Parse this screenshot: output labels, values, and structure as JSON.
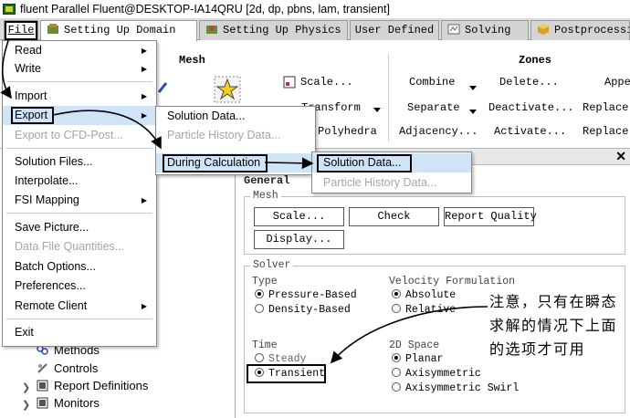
{
  "window": {
    "title": "fluent Parallel Fluent@DESKTOP-IA14QRU  [2d, dp, pbns, lam, transient]"
  },
  "tabs": {
    "file": "File",
    "items": [
      {
        "label": "Setting Up Domain",
        "icon": "domain-icon"
      },
      {
        "label": "Setting Up Physics",
        "icon": "physics-icon"
      },
      {
        "label": "User Defined",
        "icon": ""
      },
      {
        "label": "Solving",
        "icon": "solving-icon"
      },
      {
        "label": "Postprocessi",
        "icon": "postprocessing-icon"
      }
    ]
  },
  "ribbon": {
    "mesh_group": "Mesh",
    "zones_group": "Zones",
    "mesh_items": {
      "scale": "Scale...",
      "transform": "Transform",
      "polyhedra": "Polyhedra"
    },
    "zones": {
      "combine": "Combine",
      "delete": "Delete...",
      "append": "Appe",
      "separate": "Separate",
      "deactivate": "Deactivate...",
      "replace1": "Replace",
      "adjacency": "Adjacency...",
      "activate": "Activate...",
      "replace2": "Replace"
    }
  },
  "file_menu": {
    "items": [
      {
        "label": "Read",
        "submenu": true,
        "enabled": true
      },
      {
        "label": "Write",
        "submenu": true,
        "enabled": true
      },
      {
        "label": "Import",
        "submenu": true,
        "enabled": true
      },
      {
        "label": "Export",
        "submenu": true,
        "enabled": true
      },
      {
        "label": "Export to CFD-Post...",
        "submenu": false,
        "enabled": false
      },
      {
        "label": "Solution Files...",
        "submenu": false,
        "enabled": true
      },
      {
        "label": "Interpolate...",
        "submenu": false,
        "enabled": true
      },
      {
        "label": "FSI Mapping",
        "submenu": true,
        "enabled": true
      },
      {
        "label": "Save Picture...",
        "submenu": false,
        "enabled": true
      },
      {
        "label": "Data File Quantities...",
        "submenu": false,
        "enabled": false
      },
      {
        "label": "Batch Options...",
        "submenu": false,
        "enabled": true
      },
      {
        "label": "Preferences...",
        "submenu": false,
        "enabled": true
      },
      {
        "label": "Remote Client",
        "submenu": true,
        "enabled": true
      },
      {
        "label": "Exit",
        "submenu": false,
        "enabled": true
      }
    ]
  },
  "export_menu": {
    "solution_data": "Solution Data...",
    "particle_history": "Particle History Data...",
    "during_calc": "During Calculation"
  },
  "during_menu": {
    "solution_data": "Solution Data...",
    "particle_history": "Particle History Data..."
  },
  "tree": {
    "partial1": "s",
    "partial2": "ns",
    "items": [
      {
        "label": "Methods",
        "icon": "methods-icon"
      },
      {
        "label": "Controls",
        "icon": "controls-icon"
      },
      {
        "label": "Report Definitions",
        "icon": "report-definitions-icon"
      },
      {
        "label": "Monitors",
        "icon": "monitors-icon"
      }
    ]
  },
  "general": {
    "title": "General",
    "mesh_legend": "Mesh",
    "buttons": {
      "scale": "Scale...",
      "check": "Check",
      "report_quality": "Report Quality",
      "display": "Display..."
    },
    "solver_legend": "Solver",
    "type_label": "Type",
    "type_options": [
      "Pressure-Based",
      "Density-Based"
    ],
    "velocity_label": "Velocity Formulation",
    "velocity_options": [
      "Absolute",
      "Relative"
    ],
    "time_label": "Time",
    "time_options": [
      "Steady",
      "Transient"
    ],
    "space_label": "2D Space",
    "space_options": [
      "Planar",
      "Axisymmetric",
      "Axisymmetric Swirl"
    ]
  },
  "annotation": {
    "text": "注意，只有在瞬态求解的情况下上面的选项才可用",
    "color": "#000000"
  },
  "colors": {
    "highlight": "#cfe4f7",
    "disabled_text": "#a6a6a6",
    "ribbon_bg": "#dcdcdc"
  }
}
